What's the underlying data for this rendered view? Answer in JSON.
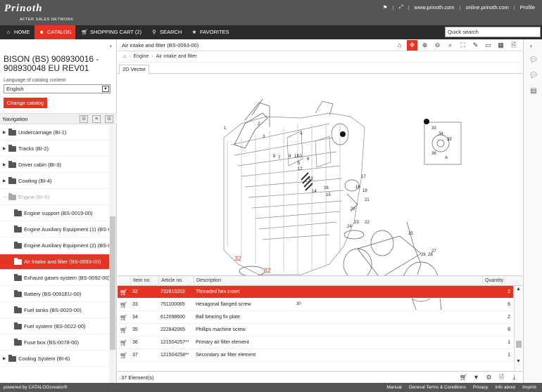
{
  "brand": {
    "name": "Prinoth",
    "tagline": "AFTER SALES NETWORK"
  },
  "toplinks": {
    "site1": "www.prinoth.com",
    "site2": "online.prinoth.com",
    "profile": "Profile"
  },
  "nav": {
    "home": "HOME",
    "catalog": "CATALOG",
    "cart": "SHOPPING CART (2)",
    "search": "SEARCH",
    "favorites": "FAVORITES",
    "quick_search_placeholder": "Quick search"
  },
  "left": {
    "title": "BISON (BS) 908930016 - 908930048 EU REV01",
    "lang_label": "Language of catalog content",
    "lang_value": "English",
    "change_button": "Change catalog",
    "nav_title": "Navigation",
    "tree": [
      {
        "label": "Undercarriage (BI-1)",
        "level": 0,
        "state": "collapsed"
      },
      {
        "label": "Tracks (BI-2)",
        "level": 0,
        "state": "collapsed"
      },
      {
        "label": "Driver cabin (BI-3)",
        "level": 0,
        "state": "collapsed"
      },
      {
        "label": "Cowling (BI-4)",
        "level": 0,
        "state": "collapsed"
      },
      {
        "label": "Engine (BI-5)",
        "level": 0,
        "state": "expanded"
      },
      {
        "label": "Engine support (BS-0019-00)",
        "level": 1,
        "state": "leaf"
      },
      {
        "label": "Engine Auxiliary Equipment (1) (BS-0",
        "level": 1,
        "state": "leaf"
      },
      {
        "label": "Engine Auxiliary Equipment (2) (BS-0",
        "level": 1,
        "state": "leaf"
      },
      {
        "label": "Air intake and filter (BS-0093-00)",
        "level": 1,
        "state": "selected"
      },
      {
        "label": "Exhaust gases system (BS-0092-00)",
        "level": 1,
        "state": "leaf"
      },
      {
        "label": "Battery (BS-0091EU-00)",
        "level": 1,
        "state": "leaf"
      },
      {
        "label": "Fuel tanks (BS-0020-00)",
        "level": 1,
        "state": "leaf"
      },
      {
        "label": "Fuel system (BS-0022-00)",
        "level": 1,
        "state": "leaf"
      },
      {
        "label": "Fuse box (BS-0078-00)",
        "level": 1,
        "state": "leaf"
      },
      {
        "label": "Cooling System (BI-6)",
        "level": 0,
        "state": "collapsed"
      }
    ]
  },
  "main": {
    "title": "Air intake and filter (BS-0093-00)",
    "breadcrumb": [
      "Engine",
      "Air intake and filter"
    ],
    "tab": "2D Vector",
    "callouts": [
      "1",
      "2",
      "3",
      "4",
      "5",
      "6",
      "7",
      "8",
      "9",
      "10",
      "11",
      "12",
      "13",
      "14",
      "15",
      "16",
      "17",
      "18",
      "19",
      "20",
      "21",
      "22",
      "23",
      "24",
      "25",
      "26",
      "27",
      "28",
      "29",
      "30",
      "31",
      "32",
      "33",
      "34",
      "35",
      "36",
      "A"
    ],
    "highlight_callout": "32"
  },
  "grid": {
    "headers": {
      "item": "Item no.",
      "article": "Article no.",
      "desc": "Description",
      "qty": "Quantity"
    },
    "rows": [
      {
        "item": "32",
        "article": "732610202",
        "desc": "Threaded hex insert",
        "qty": "2",
        "selected": true
      },
      {
        "item": "33",
        "article": "751100065",
        "desc": "Hexagonal flanged screw",
        "qty": "6",
        "selected": false
      },
      {
        "item": "34",
        "article": "612098600",
        "desc": "Ball bearing fix plate",
        "qty": "2",
        "selected": false
      },
      {
        "item": "35",
        "article": "222842065",
        "desc": "Phillips machine screw",
        "qty": "6",
        "selected": false
      },
      {
        "item": "36",
        "article": "121504257**",
        "desc": "Primary air filter element",
        "qty": "1",
        "selected": false
      },
      {
        "item": "37",
        "article": "121504258**",
        "desc": "Secondary air filter element",
        "qty": "1",
        "selected": false
      }
    ],
    "count": "37 Element(s)"
  },
  "footer": {
    "powered": "powered by CATALOGcreator®",
    "links": [
      "Manual",
      "General Terms & Conditions",
      "Privacy",
      "Info about",
      "Imprint"
    ]
  },
  "colors": {
    "accent": "#e63323",
    "header_bg": "#555555",
    "nav_bg": "#2b2b2b"
  }
}
